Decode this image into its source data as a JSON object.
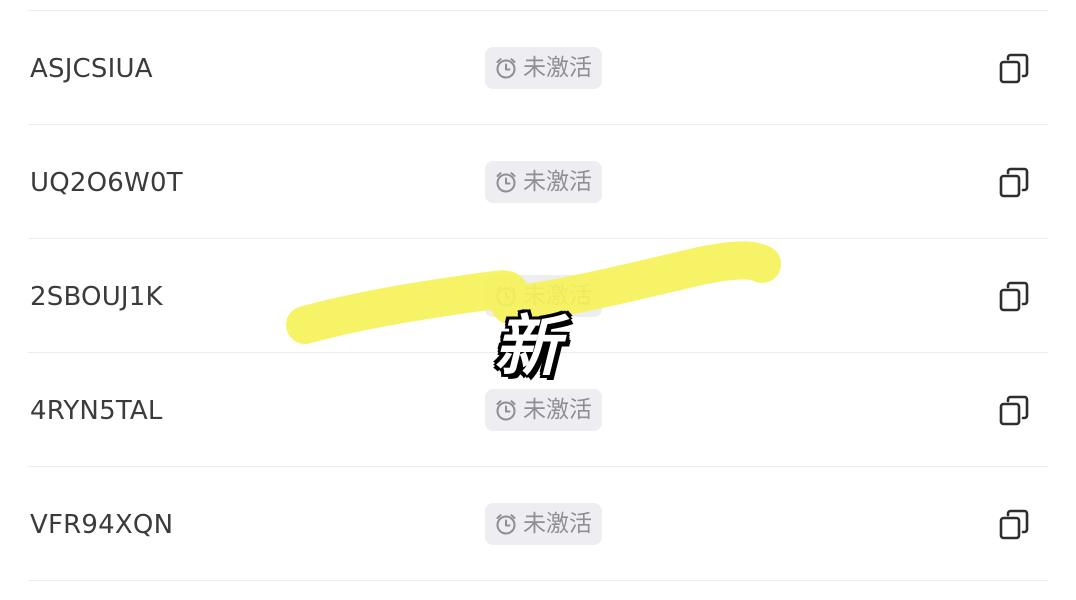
{
  "codes": [
    {
      "code": "ASJCSIUA",
      "status": "未激活"
    },
    {
      "code": "UQ2O6W0T",
      "status": "未激活"
    },
    {
      "code": "2SBOUJ1K",
      "status": "未激活"
    },
    {
      "code": "4RYN5TAL",
      "status": "未激活"
    },
    {
      "code": "VFR94XQN",
      "status": "未激活"
    }
  ],
  "icons": {
    "status": "clock-icon",
    "action": "copy-icon"
  },
  "overlay": {
    "caption": "新",
    "highlight_color": "#f6f25a"
  },
  "colors": {
    "tag_background": "#eeeef2",
    "tag_text": "#8e8e96",
    "code_text": "#3b3b3b",
    "divider": "#ececec"
  }
}
